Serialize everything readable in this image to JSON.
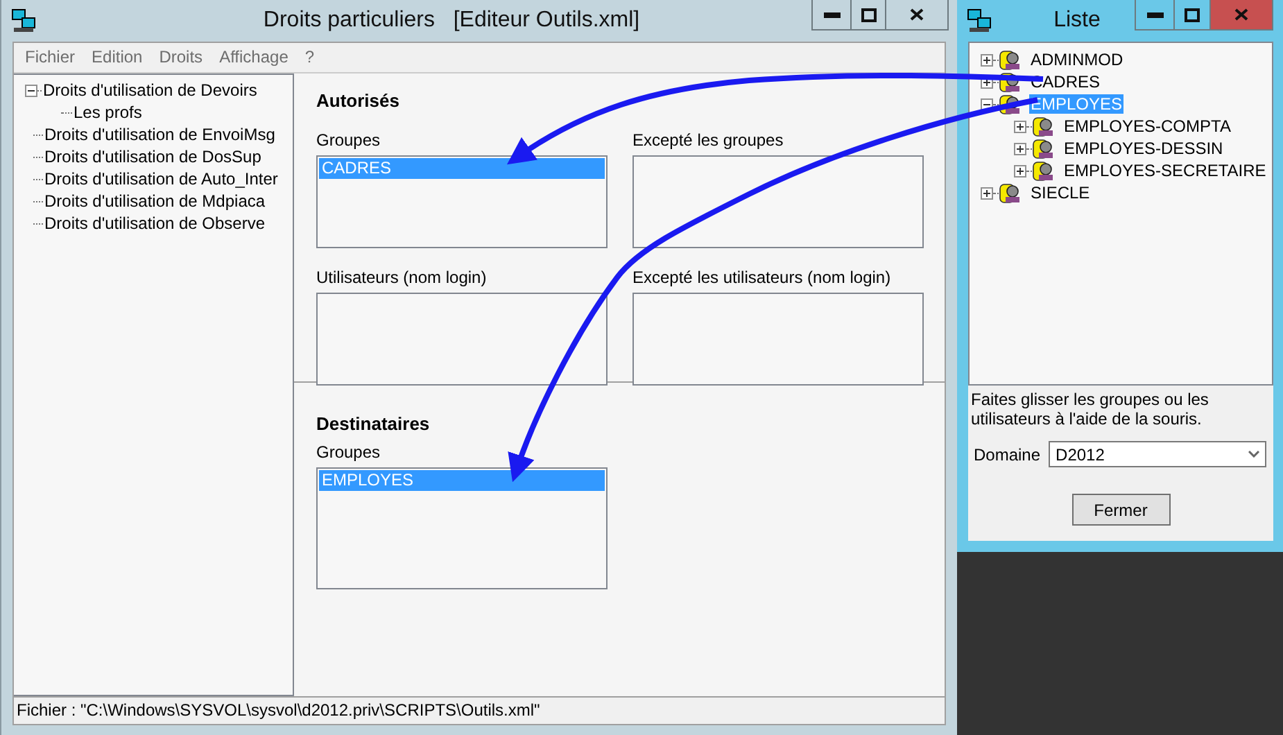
{
  "main_window": {
    "title": "Droits particuliers   [Editeur Outils.xml]",
    "menu": [
      "Fichier",
      "Edition",
      "Droits",
      "Affichage",
      "?"
    ],
    "tree": [
      {
        "label": "Droits d'utilisation de Devoirs",
        "expanded": true,
        "children": [
          {
            "label": "Les profs"
          }
        ]
      },
      {
        "label": "Droits d'utilisation de EnvoiMsg"
      },
      {
        "label": "Droits d'utilisation de DosSup"
      },
      {
        "label": "Droits d'utilisation de Auto_Inter"
      },
      {
        "label": "Droits d'utilisation de Mdpiaca"
      },
      {
        "label": "Droits d'utilisation de Observe"
      }
    ],
    "autorises": {
      "heading": "Autorisés",
      "lists": [
        {
          "label": "Groupes",
          "items": [
            {
              "text": "CADRES",
              "selected": true
            }
          ]
        },
        {
          "label": "Excepté les groupes"
        },
        {
          "label": "Utilisateurs (nom login)"
        },
        {
          "label": "Excepté les utilisateurs (nom login)"
        }
      ]
    },
    "destinataires": {
      "heading": "Destinataires",
      "lists": [
        {
          "label": "Groupes",
          "items": [
            {
              "text": "EMPLOYES",
              "selected": true
            }
          ]
        }
      ]
    },
    "status_bar": "Fichier : \"C:\\Windows\\SYSVOL\\sysvol\\d2012.priv\\SCRIPTS\\Outils.xml\""
  },
  "liste_window": {
    "title": "Liste",
    "tree": [
      {
        "label": "ADMINMOD",
        "expanded": false,
        "selected": false
      },
      {
        "label": "CADRES",
        "expanded": false,
        "selected": false
      },
      {
        "label": "EMPLOYES",
        "expanded": true,
        "selected": true,
        "children": [
          {
            "label": "EMPLOYES-COMPTA",
            "expanded": false,
            "selected": false
          },
          {
            "label": "EMPLOYES-DESSIN",
            "expanded": false,
            "selected": false
          },
          {
            "label": "EMPLOYES-SECRETAIRE",
            "expanded": false,
            "selected": false
          }
        ]
      },
      {
        "label": "SIECLE",
        "expanded": false,
        "selected": false
      }
    ],
    "hint": "Faites glisser les groupes ou les utilisateurs à l'aide de la souris.",
    "domain_label": "Domaine",
    "domain_value": "D2012",
    "close_button": "Fermer"
  }
}
